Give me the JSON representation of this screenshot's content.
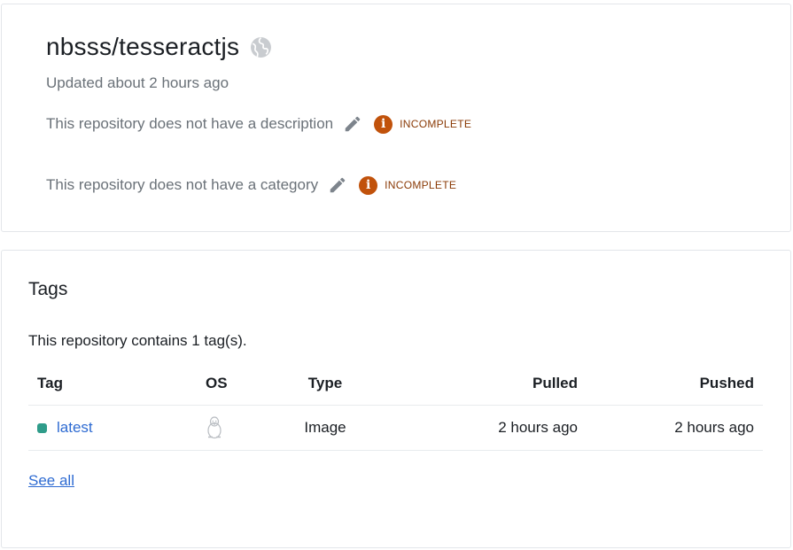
{
  "repo": {
    "title": "nbsss/tesseractjs",
    "updated": "Updated about 2 hours ago",
    "visibility_icon": "globe-icon",
    "description": {
      "text": "This repository does not have a description",
      "status": "INCOMPLETE"
    },
    "category": {
      "text": "This repository does not have a category",
      "status": "INCOMPLETE"
    }
  },
  "tags": {
    "title": "Tags",
    "count_text": "This repository contains 1 tag(s).",
    "columns": [
      "Tag",
      "OS",
      "Type",
      "Pulled",
      "Pushed"
    ],
    "rows": [
      {
        "tag": "latest",
        "os_icon": "linux-icon",
        "type": "Image",
        "pulled": "2 hours ago",
        "pushed": "2 hours ago"
      }
    ],
    "see_all": "See all"
  },
  "colors": {
    "incomplete_badge": "#c1520b",
    "incomplete_text": "#8a3a06",
    "link": "#2e6bd2",
    "tag_status": "#2f9c8a"
  }
}
